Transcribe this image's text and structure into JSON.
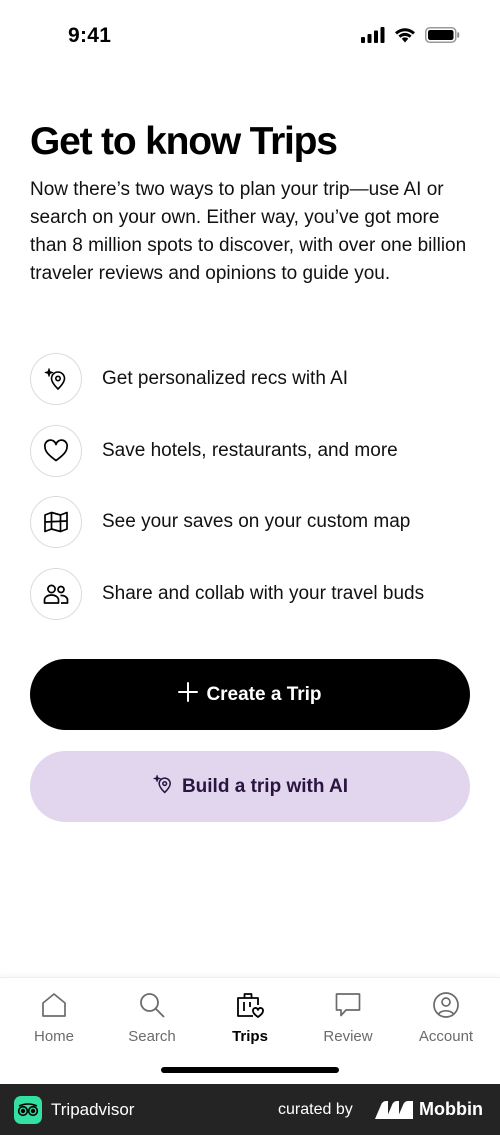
{
  "status": {
    "time": "9:41"
  },
  "page": {
    "title": "Get to know Trips",
    "intro": "Now there’s two ways to plan your trip—use AI or search on your own. Either way, you’ve got more than 8 million spots to discover, with over one billion traveler reviews and opinions to guide you."
  },
  "features": [
    {
      "icon": "sparkle-pin-icon",
      "label": "Get personalized recs with AI"
    },
    {
      "icon": "heart-icon",
      "label": "Save hotels, restaurants, and more"
    },
    {
      "icon": "map-icon",
      "label": "See your saves on your custom map"
    },
    {
      "icon": "people-icon",
      "label": "Share and collab with your travel buds"
    }
  ],
  "buttons": {
    "create_trip": "Create a Trip",
    "build_ai": "Build a trip with AI"
  },
  "tabs": [
    {
      "label": "Home",
      "icon": "home-icon",
      "active": false
    },
    {
      "label": "Search",
      "icon": "search-icon",
      "active": false
    },
    {
      "label": "Trips",
      "icon": "trips-icon",
      "active": true
    },
    {
      "label": "Review",
      "icon": "review-icon",
      "active": false
    },
    {
      "label": "Account",
      "icon": "account-icon",
      "active": false
    }
  ],
  "footer": {
    "brand": "Tripadvisor",
    "curated_by": "curated by",
    "curator": "Mobbin"
  },
  "colors": {
    "primary_button": "#000000",
    "ai_button": "#e2d6ee",
    "ai_button_text": "#2a1540",
    "tripadvisor_green": "#34e0a1"
  }
}
